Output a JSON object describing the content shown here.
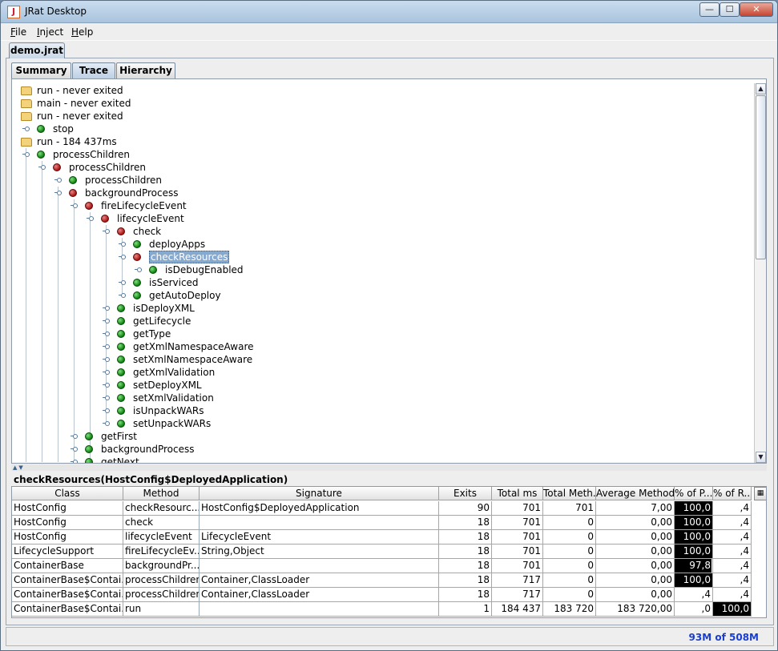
{
  "window": {
    "title": "JRat Desktop"
  },
  "menu": [
    {
      "label": "File",
      "mnemonic": "F",
      "rest": "ile"
    },
    {
      "label": "Inject",
      "mnemonic": "I",
      "rest": "nject"
    },
    {
      "label": "Help",
      "mnemonic": "H",
      "rest": "elp"
    }
  ],
  "document_tab": "demo.jrat",
  "view_tabs": [
    {
      "label": "Summary",
      "active": false
    },
    {
      "label": "Trace",
      "active": true
    },
    {
      "label": "Hierarchy",
      "active": false
    }
  ],
  "tree": [
    {
      "label": "run - never exited",
      "icon": "folder",
      "depth": 0
    },
    {
      "label": "main - never exited",
      "icon": "folder",
      "depth": 0
    },
    {
      "label": "run - never exited",
      "icon": "folder",
      "depth": 0
    },
    {
      "label": "stop",
      "icon": "green",
      "depth": 1
    },
    {
      "label": "run - 184 437ms",
      "icon": "folder",
      "depth": 0
    },
    {
      "label": "processChildren",
      "icon": "green",
      "depth": 1
    },
    {
      "label": "processChildren",
      "icon": "red",
      "depth": 2
    },
    {
      "label": "processChildren",
      "icon": "green",
      "depth": 3
    },
    {
      "label": "backgroundProcess",
      "icon": "red",
      "depth": 3
    },
    {
      "label": "fireLifecycleEvent",
      "icon": "red",
      "depth": 4
    },
    {
      "label": "lifecycleEvent",
      "icon": "red",
      "depth": 5
    },
    {
      "label": "check",
      "icon": "red",
      "depth": 6
    },
    {
      "label": "deployApps",
      "icon": "green",
      "depth": 7
    },
    {
      "label": "checkResources",
      "icon": "red",
      "depth": 7,
      "selected": true
    },
    {
      "label": "isDebugEnabled",
      "icon": "green",
      "depth": 8
    },
    {
      "label": "isServiced",
      "icon": "green",
      "depth": 7
    },
    {
      "label": "getAutoDeploy",
      "icon": "green",
      "depth": 7
    },
    {
      "label": "isDeployXML",
      "icon": "green",
      "depth": 6
    },
    {
      "label": "getLifecycle",
      "icon": "green",
      "depth": 6
    },
    {
      "label": "getType",
      "icon": "green",
      "depth": 6
    },
    {
      "label": "getXmlNamespaceAware",
      "icon": "green",
      "depth": 6
    },
    {
      "label": "setXmlNamespaceAware",
      "icon": "green",
      "depth": 6
    },
    {
      "label": "getXmlValidation",
      "icon": "green",
      "depth": 6
    },
    {
      "label": "setDeployXML",
      "icon": "green",
      "depth": 6
    },
    {
      "label": "setXmlValidation",
      "icon": "green",
      "depth": 6
    },
    {
      "label": "isUnpackWARs",
      "icon": "green",
      "depth": 6
    },
    {
      "label": "setUnpackWARs",
      "icon": "green",
      "depth": 6
    },
    {
      "label": "getFirst",
      "icon": "green",
      "depth": 4
    },
    {
      "label": "backgroundProcess",
      "icon": "green",
      "depth": 4
    },
    {
      "label": "getNext",
      "icon": "green",
      "depth": 4
    }
  ],
  "detail": {
    "title": "checkResources(HostConfig$DeployedApplication)",
    "columns": [
      "Class",
      "Method",
      "Signature",
      "Exits",
      "Total ms",
      "Total Meth...",
      "Average Method...",
      "% of P...",
      "% of R..."
    ],
    "rows": [
      [
        "HostConfig",
        "checkResourc...",
        "HostConfig$DeployedApplication",
        "90",
        "701",
        "701",
        "7,00",
        "100,0",
        ",4"
      ],
      [
        "HostConfig",
        "check",
        "",
        "18",
        "701",
        "0",
        "0,00",
        "100,0",
        ",4"
      ],
      [
        "HostConfig",
        "lifecycleEvent",
        "LifecycleEvent",
        "18",
        "701",
        "0",
        "0,00",
        "100,0",
        ",4"
      ],
      [
        "LifecycleSupport",
        "fireLifecycleEv...",
        "String,Object",
        "18",
        "701",
        "0",
        "0,00",
        "100,0",
        ",4"
      ],
      [
        "ContainerBase",
        "backgroundPr...",
        "",
        "18",
        "701",
        "0",
        "0,00",
        "97,8",
        ",4"
      ],
      [
        "ContainerBase$Contai...",
        "processChildren",
        "Container,ClassLoader",
        "18",
        "717",
        "0",
        "0,00",
        "100,0",
        ",4"
      ],
      [
        "ContainerBase$Contai...",
        "processChildren",
        "Container,ClassLoader",
        "18",
        "717",
        "0",
        "0,00",
        ",4",
        ",4"
      ],
      [
        "ContainerBase$Contai...",
        "run",
        "",
        "1",
        "184 437",
        "183 720",
        "183 720,00",
        ",0",
        "100,0"
      ]
    ],
    "pct_parent_fill": [
      1.0,
      1.0,
      1.0,
      1.0,
      0.978,
      1.0,
      0.004,
      0.0
    ],
    "pct_root_fill": [
      0.004,
      0.004,
      0.004,
      0.004,
      0.004,
      0.004,
      0.004,
      1.0
    ]
  },
  "status": {
    "memory": "93M of 508M"
  },
  "colors": {
    "memory_text": "#1a3fd0",
    "green_node": "#0c7d0c",
    "red_node": "#a31515"
  }
}
